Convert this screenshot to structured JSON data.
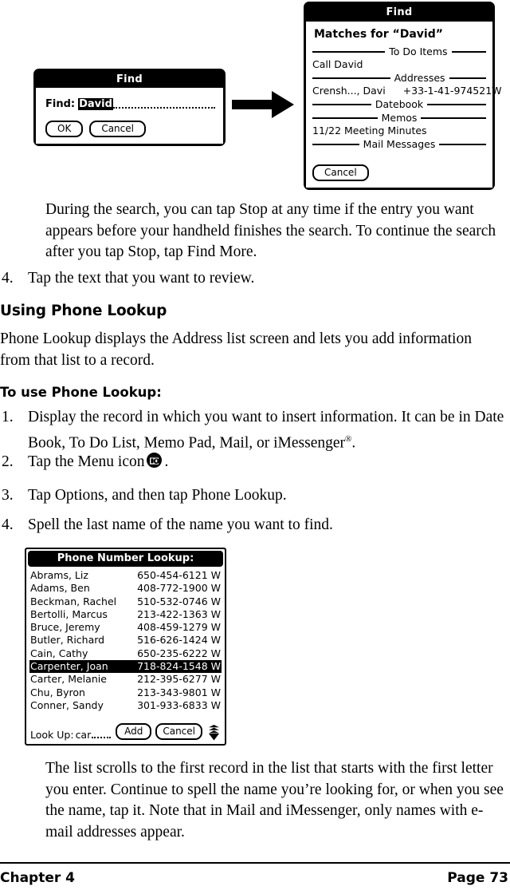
{
  "find_dialog": {
    "title": "Find",
    "field_label": "Find:",
    "field_value": "David",
    "ok_label": "OK",
    "cancel_label": "Cancel"
  },
  "matches_dialog": {
    "title": "Find",
    "heading": "Matches for “David”",
    "sections": [
      {
        "label": "To Do Items",
        "items": [
          {
            "name": "Call David",
            "number": ""
          }
        ]
      },
      {
        "label": "Addresses",
        "items": [
          {
            "name": "Crensh..., Davi",
            "number": "+33-1-41-974521W"
          }
        ]
      },
      {
        "label": "Datebook",
        "items": []
      },
      {
        "label": "Memos",
        "items": [
          {
            "name": "11/22 Meeting Minutes",
            "number": ""
          }
        ]
      },
      {
        "label": "Mail Messages",
        "items": []
      }
    ],
    "cancel_label": "Cancel"
  },
  "lookup_screen": {
    "title": "Phone Number Lookup:",
    "rows": [
      {
        "name": "Abrams, Liz",
        "number": "650-454-6121 W",
        "selected": false
      },
      {
        "name": "Adams, Ben",
        "number": "408-772-1900 W",
        "selected": false
      },
      {
        "name": "Beckman, Rachel",
        "number": "510-532-0746 W",
        "selected": false
      },
      {
        "name": "Bertolli, Marcus",
        "number": "213-422-1363 W",
        "selected": false
      },
      {
        "name": "Bruce, Jeremy",
        "number": "408-459-1279 W",
        "selected": false
      },
      {
        "name": "Butler, Richard",
        "number": "516-626-1424 W",
        "selected": false
      },
      {
        "name": "Cain, Cathy",
        "number": "650-235-6222 W",
        "selected": false
      },
      {
        "name": "Carpenter, Joan",
        "number": "718-824-1548 W",
        "selected": true
      },
      {
        "name": "Carter, Melanie",
        "number": "212-395-6277 W",
        "selected": false
      },
      {
        "name": "Chu, Byron",
        "number": "213-343-9801 W",
        "selected": false
      },
      {
        "name": "Conner, Sandy",
        "number": "301-933-6833 W",
        "selected": false
      }
    ],
    "lookup_label": "Look Up:",
    "lookup_value": "car",
    "add_label": "Add",
    "cancel_label": "Cancel"
  },
  "content": {
    "note_after_step3": "During the search, you can tap Stop at any time if the entry you want appears before your handheld finishes the search. To continue the search after you tap Stop, tap Find More.",
    "step4_find": {
      "num": "4.",
      "text": "Tap the text that you want to review."
    },
    "section_heading": "Using Phone Lookup",
    "section_intro": "Phone Lookup displays the Address list screen and lets you add information from that list to a record.",
    "subheading": "To use Phone Lookup:",
    "steps": [
      {
        "num": "1.",
        "text_before": "Display the record in which you want to insert information. It can be in Date Book, To Do List, Memo Pad, Mail, or iMessenger",
        "sup": "®",
        "text_after": "."
      },
      {
        "num": "2.",
        "text_before": "Tap the Menu icon",
        "icon": "menu-icon",
        "text_after": "."
      },
      {
        "num": "3.",
        "text_before": "Tap Options, and then tap Phone Lookup.",
        "text_after": ""
      },
      {
        "num": "4.",
        "text_before": "Spell the last name of the name you want to find.",
        "text_after": ""
      }
    ],
    "closing_note": "The list scrolls to the first record in the list that starts with the first letter you enter. Continue to spell the name you’re looking for, or when you see the name, tap it. Note that in Mail and iMessenger, only names with e-mail addresses appear."
  },
  "footer": {
    "left": "Chapter 4",
    "right": "Page 73"
  },
  "colors": {
    "ink": "#000000",
    "paper": "#ffffff"
  }
}
